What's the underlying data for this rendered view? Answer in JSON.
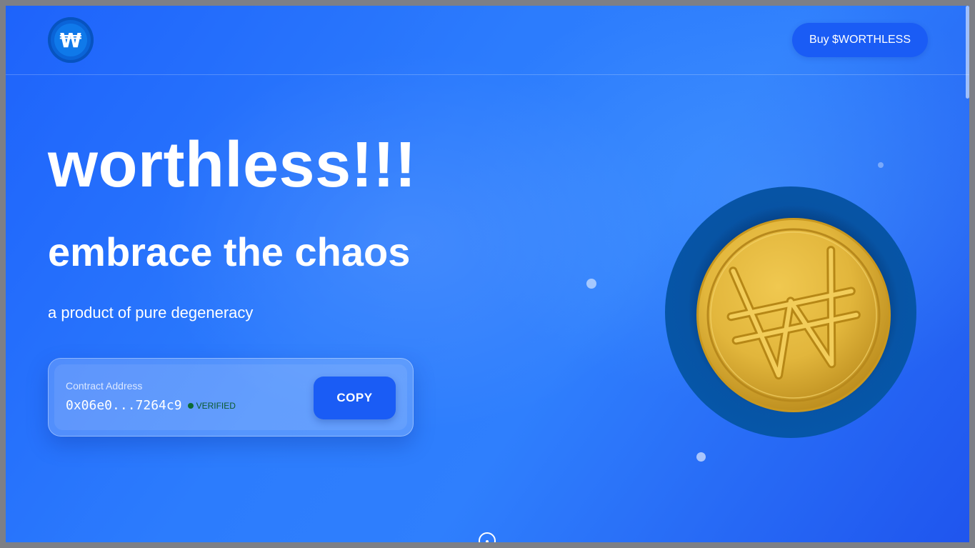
{
  "header": {
    "logo_glyph": "₩",
    "buy_button_label": "Buy $WORTHLESS"
  },
  "hero": {
    "title": "worthless!!!",
    "subtitle": "embrace the chaos",
    "tagline": "a product of pure degeneracy"
  },
  "contract": {
    "label": "Contract Address",
    "address_short": "0x06e0...7264c9",
    "status": "VERIFIED",
    "copy_label": "COPY"
  },
  "coin": {
    "glyph": "₩"
  },
  "colors": {
    "background": "#2a76fc",
    "button": "#1a5cf5",
    "coin_gold": "#e2b63c",
    "coin_ring": "#0656a8",
    "verified_green": "#0b6a34"
  },
  "icons": [
    "won-logo-icon",
    "coin-icon",
    "scroll-down-icon",
    "status-dot-icon"
  ]
}
